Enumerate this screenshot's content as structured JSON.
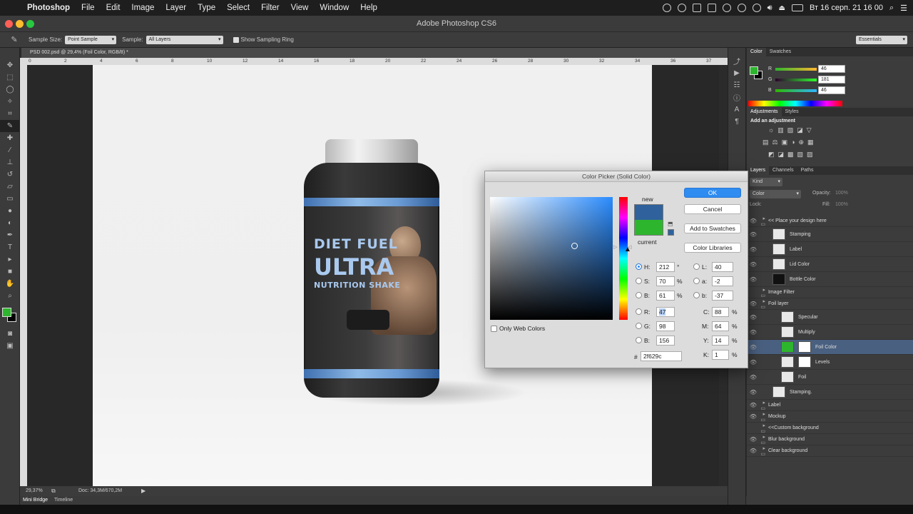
{
  "menubar": {
    "app": "Photoshop",
    "items": [
      "File",
      "Edit",
      "Image",
      "Layer",
      "Type",
      "Select",
      "Filter",
      "View",
      "Window",
      "Help"
    ],
    "datetime": "Вт 16 серп.  21 16 00"
  },
  "window": {
    "title": "Adobe Photoshop CS6"
  },
  "options": {
    "sample_size_label": "Sample Size:",
    "sample_size_value": "Point Sample",
    "sample_label": "Sample:",
    "sample_value": "All Layers",
    "show_ring_label": "Show Sampling Ring",
    "workspace": "Essentials"
  },
  "document": {
    "tab": "PSD 002.psd @ 29,4% (Foil Color, RGB/8) *",
    "zoom": "29,37%",
    "doc_info": "Doc: 34,3M/670,2M",
    "ruler_ticks": [
      "0",
      "2",
      "4",
      "6",
      "8",
      "10",
      "12",
      "14",
      "16",
      "18",
      "20",
      "22",
      "24",
      "26",
      "28",
      "30",
      "32",
      "34",
      "36",
      "37"
    ]
  },
  "product": {
    "line1": "DIET FUEL",
    "line2": "ULTRA",
    "line3": "NUTRITION SHAKE"
  },
  "bottom_tabs": [
    "Mini Bridge",
    "Timeline"
  ],
  "color_panel": {
    "tabs": [
      "Color",
      "Swatches"
    ],
    "r": "46",
    "g": "181",
    "b": "46",
    "r_label": "R",
    "g_label": "G",
    "b_label": "B"
  },
  "adjustments": {
    "tabs": [
      "Adjustments",
      "Styles"
    ],
    "hint": "Add an adjustment"
  },
  "layers": {
    "tabs": [
      "Layers",
      "Channels",
      "Paths"
    ],
    "kind": "Kind",
    "blend": "Color",
    "opacity_label": "Opacity:",
    "opacity": "100%",
    "lock_label": "Lock:",
    "fill_label": "Fill:",
    "fill": "100%",
    "rows": [
      {
        "name": "<< Place your design here"
      },
      {
        "name": "Stamping"
      },
      {
        "name": "Label"
      },
      {
        "name": "Lid Color"
      },
      {
        "name": "Bottle Color"
      },
      {
        "name": "Image Filter"
      },
      {
        "name": "Foil layer"
      },
      {
        "name": "Specular"
      },
      {
        "name": "Multiply"
      },
      {
        "name": "Foil Color"
      },
      {
        "name": "Levels"
      },
      {
        "name": "Foil"
      },
      {
        "name": "Stamping."
      },
      {
        "name": "Label"
      },
      {
        "name": "Mockup"
      },
      {
        "name": "<<Custom background"
      },
      {
        "name": "Blur background"
      },
      {
        "name": "Clear background"
      }
    ]
  },
  "picker": {
    "title": "Color Picker (Solid Color)",
    "ok": "OK",
    "cancel": "Cancel",
    "add_swatches": "Add to Swatches",
    "libraries": "Color Libraries",
    "new_label": "new",
    "current_label": "current",
    "only_web": "Only Web Colors",
    "new_color": "#2f629c",
    "current_color": "#2eb52e",
    "h": "212",
    "s": "70",
    "b": "61",
    "r": "47",
    "g": "98",
    "b2": "156",
    "L": "40",
    "a": "-2",
    "b3": "-37",
    "C": "88",
    "M": "64",
    "Y": "14",
    "K": "1",
    "hex": "2f629c",
    "labels": {
      "h": "H:",
      "s": "S:",
      "b": "B:",
      "r": "R:",
      "g": "G:",
      "b2": "B:",
      "L": "L:",
      "a": "a:",
      "b3": "b:",
      "C": "C:",
      "M": "M:",
      "Y": "Y:",
      "K": "K:",
      "hash": "#"
    },
    "units": {
      "deg": "°",
      "pct": "%"
    }
  }
}
